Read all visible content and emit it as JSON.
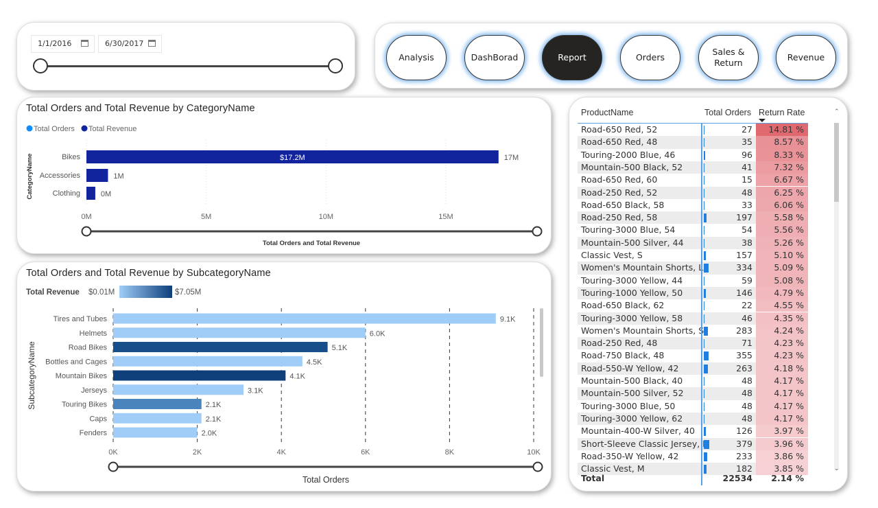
{
  "date_filter": {
    "start": "1/1/2016",
    "end": "6/30/2017",
    "range_fraction": [
      0,
      1
    ]
  },
  "nav": {
    "buttons": [
      {
        "label": "Analysis",
        "active": false
      },
      {
        "label": "DashBorad",
        "active": false
      },
      {
        "label": "Report",
        "active": true
      },
      {
        "label": "Orders",
        "active": false
      },
      {
        "label": "Sales &\nReturn",
        "active": false
      },
      {
        "label": "Revenue",
        "active": false
      }
    ]
  },
  "chart_data": [
    {
      "type": "bar",
      "orientation": "horizontal",
      "title": "Total Orders and Total Revenue by CategoryName",
      "legend": [
        {
          "name": "Total Orders",
          "color": "#118dff"
        },
        {
          "name": "Total Revenue",
          "color": "#12239e"
        }
      ],
      "legend_position": "top-left",
      "ylabel": "CategoryName",
      "xlabel": "Total Orders and Total Revenue",
      "categories": [
        "Bikes",
        "Accessories",
        "Clothing"
      ],
      "series": [
        {
          "name": "Total Revenue",
          "values": [
            17.2,
            0.9,
            0.37
          ],
          "color": "#12239e"
        }
      ],
      "data_labels": [
        "17M",
        "1M",
        "0M"
      ],
      "inside_labels": [
        "$17.2M",
        "",
        ""
      ],
      "xticks": [
        "0M",
        "5M",
        "10M",
        "15M"
      ],
      "xtick_values": [
        0,
        5,
        10,
        15
      ],
      "xlim": [
        0,
        15
      ],
      "grid": true
    },
    {
      "type": "bar",
      "orientation": "horizontal",
      "title": "Total Orders and Total Revenue by SubcategoryName",
      "color_legend": {
        "label": "Total Revenue",
        "min": "$0.01M",
        "max": "$7.05M",
        "colors": [
          "#9fcdf8",
          "#0e3f7a"
        ]
      },
      "ylabel": "SubcategoryName",
      "xlabel": "Total Orders",
      "categories": [
        "Tires and Tubes",
        "Helmets",
        "Road Bikes",
        "Bottles and Cages",
        "Mountain Bikes",
        "Jerseys",
        "Touring Bikes",
        "Caps",
        "Fenders"
      ],
      "values": [
        9.1,
        6.0,
        5.1,
        4.5,
        4.1,
        3.1,
        2.1,
        2.1,
        2.0
      ],
      "data_labels": [
        "9.1K",
        "6.0K",
        "5.1K",
        "4.5K",
        "4.1K",
        "3.1K",
        "2.1K",
        "2.1K",
        "2.0K"
      ],
      "colors": [
        "#9fcdf8",
        "#9fcdf8",
        "#174f8a",
        "#9fcdf8",
        "#0e3f7a",
        "#9fcdf8",
        "#4a84bd",
        "#9fcdf8",
        "#9fcdf8"
      ],
      "xticks": [
        "0K",
        "2K",
        "4K",
        "6K",
        "8K",
        "10K"
      ],
      "xtick_values": [
        0,
        2,
        4,
        6,
        8,
        10
      ],
      "xlim": [
        0,
        10
      ],
      "grid": true
    }
  ],
  "table": {
    "headers": [
      "ProductName",
      "Total Orders",
      "Return Rate"
    ],
    "sort": "Return Rate descending",
    "rows": [
      [
        "Road-650 Red, 52",
        "27",
        "14.81 %"
      ],
      [
        "Road-650 Red, 48",
        "35",
        "8.57 %"
      ],
      [
        "Touring-2000 Blue, 46",
        "96",
        "8.33 %"
      ],
      [
        "Mountain-500 Black, 52",
        "41",
        "7.32 %"
      ],
      [
        "Road-650 Red, 60",
        "15",
        "6.67 %"
      ],
      [
        "Road-250 Red, 52",
        "48",
        "6.25 %"
      ],
      [
        "Road-650 Black, 58",
        "33",
        "6.06 %"
      ],
      [
        "Road-250 Red, 58",
        "197",
        "5.58 %"
      ],
      [
        "Touring-3000 Blue, 54",
        "54",
        "5.56 %"
      ],
      [
        "Mountain-500 Silver, 44",
        "38",
        "5.26 %"
      ],
      [
        "Classic Vest, S",
        "157",
        "5.10 %"
      ],
      [
        "Women's Mountain Shorts, L",
        "334",
        "5.09 %"
      ],
      [
        "Touring-3000 Yellow, 44",
        "59",
        "5.08 %"
      ],
      [
        "Touring-1000 Yellow, 50",
        "146",
        "4.79 %"
      ],
      [
        "Road-650 Black, 62",
        "22",
        "4.55 %"
      ],
      [
        "Touring-3000 Yellow, 58",
        "46",
        "4.35 %"
      ],
      [
        "Women's Mountain Shorts, S",
        "283",
        "4.24 %"
      ],
      [
        "Road-250 Red, 48",
        "71",
        "4.23 %"
      ],
      [
        "Road-750 Black, 48",
        "355",
        "4.23 %"
      ],
      [
        "Road-550-W Yellow, 42",
        "263",
        "4.18 %"
      ],
      [
        "Mountain-500 Black, 40",
        "48",
        "4.17 %"
      ],
      [
        "Mountain-500 Silver, 52",
        "48",
        "4.17 %"
      ],
      [
        "Touring-3000 Blue, 50",
        "48",
        "4.17 %"
      ],
      [
        "Touring-3000 Yellow, 62",
        "48",
        "4.17 %"
      ],
      [
        "Mountain-400-W Silver, 40",
        "126",
        "3.97 %"
      ],
      [
        "Short-Sleeve Classic Jersey, M",
        "379",
        "3.96 %"
      ],
      [
        "Road-350-W Yellow, 42",
        "233",
        "3.86 %"
      ],
      [
        "Classic Vest, M",
        "182",
        "3.85 %"
      ]
    ],
    "total": {
      "label": "Total",
      "orders": "22534",
      "rate": "2.14 %"
    },
    "colors": {
      "rate_high": "#e06970",
      "rate_low": "#f7d6d9",
      "data_bar": "#1f7fe0"
    }
  }
}
